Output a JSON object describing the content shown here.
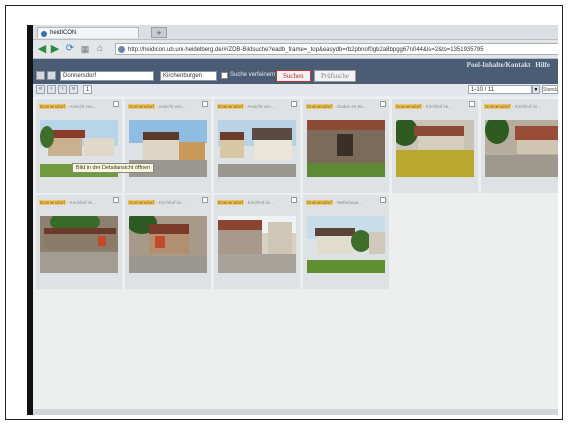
{
  "browser": {
    "tab_title": "heidICON",
    "new_tab_label": "+",
    "url": "http://heidicon.ub.uni-heidelberg.de/#/ZDB-Bildsuche?eadb_frame=_top&easydb=rb2pbnof0gb2a8bpgg67n044&ls=2&ts=1351935795"
  },
  "app": {
    "header_links": [
      "Pool-Inhalte/Kontakt",
      "Hilfe"
    ],
    "search": {
      "field_value": "Donnersdorf",
      "scope_value": "Kirchenburgen",
      "checkbox_label": "Suche verfeinern",
      "search_button": "Suchen",
      "proof_button": "Prüfsuche"
    },
    "pager": {
      "page": "1",
      "range": "1-10 / 11",
      "extra": "Standard"
    }
  },
  "tooltip": "Bild in der Detailansicht öffnen",
  "results": [
    {
      "location": "Donnersdorf",
      "rest": " - Ansicht von..."
    },
    {
      "location": "Donnersdorf",
      "rest": " - Ansicht von..."
    },
    {
      "location": "Donnersdorf",
      "rest": " - Ansicht von..."
    },
    {
      "location": "Donnersdorf",
      "rest": " - Gaden im Kir..."
    },
    {
      "location": "Donnersdorf",
      "rest": " - Kirchhof im..."
    },
    {
      "location": "Donnersdorf",
      "rest": " - Kirchhof im..."
    },
    {
      "location": "Donnersdorf",
      "rest": " - Kirchhof im..."
    },
    {
      "location": "Donnersdorf",
      "rest": " - Kirchhof im..."
    },
    {
      "location": "Donnersdorf",
      "rest": " - Kirchhof im..."
    },
    {
      "location": "Donnersdorf",
      "rest": " - Wohnhaus..."
    }
  ],
  "colors": {
    "header_bar": "#4a5d74",
    "location_highlight": "#f0c866",
    "search_button_text": "#c62828"
  },
  "icons": {
    "back": "arrow-left-icon",
    "forward": "arrow-right-icon",
    "reload": "reload-icon",
    "home": "home-icon"
  }
}
